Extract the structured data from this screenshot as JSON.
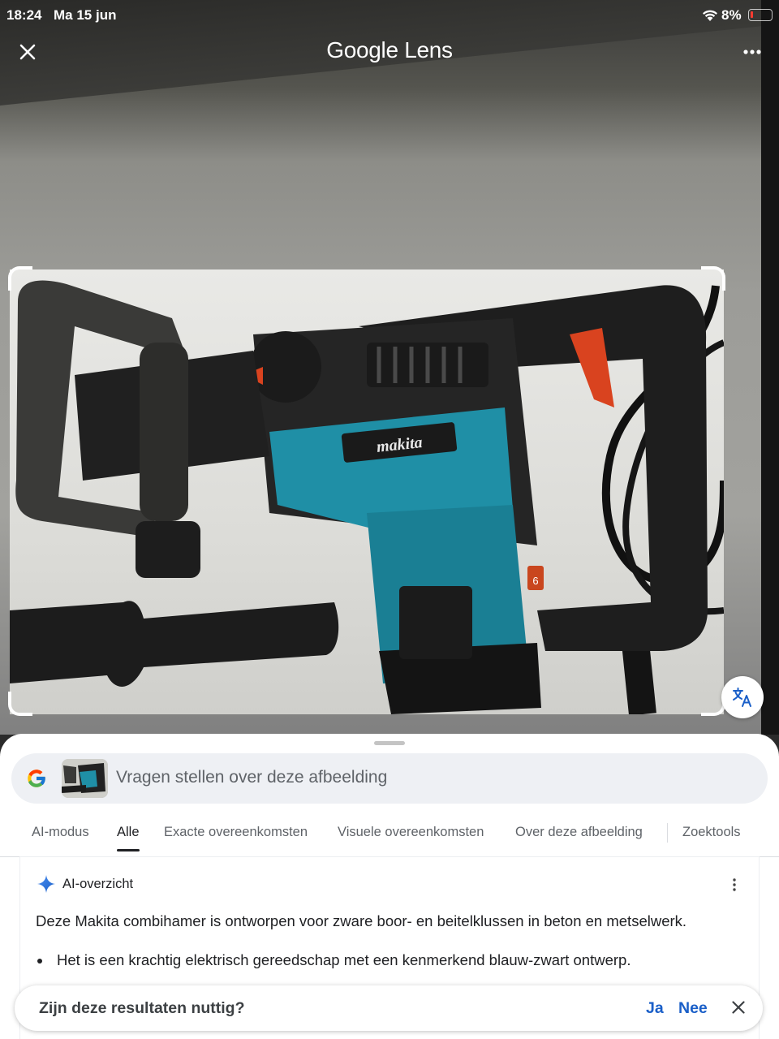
{
  "status_bar": {
    "time": "18:24",
    "date": "Ma 15 jun",
    "battery": "8%"
  },
  "header": {
    "title": "Google Lens"
  },
  "image": {
    "brand_label": "makita",
    "dial_number": "6"
  },
  "search": {
    "placeholder": "Vragen stellen over deze afbeelding"
  },
  "tabs": [
    {
      "label": "AI-modus"
    },
    {
      "label": "Alle"
    },
    {
      "label": "Exacte overeenkomsten"
    },
    {
      "label": "Visuele overeenkomsten"
    },
    {
      "label": "Over deze afbeelding"
    },
    {
      "label": "Zoektools"
    }
  ],
  "active_tab": "Alle",
  "ai_overview": {
    "title": "AI-overzicht",
    "summary": "Deze Makita combihamer is ontworpen voor zware boor- en beitelklussen in beton en metselwerk.",
    "bullets": [
      "Het is een krachtig elektrisch gereedschap met een kenmerkend blauw-zwart ontwerp."
    ]
  },
  "feedback": {
    "question": "Zijn deze resultaten nuttig?",
    "yes": "Ja",
    "no": "Nee"
  },
  "colors": {
    "accent_blue": "#1a5fc8",
    "drill_teal": "#1f8fa6"
  }
}
